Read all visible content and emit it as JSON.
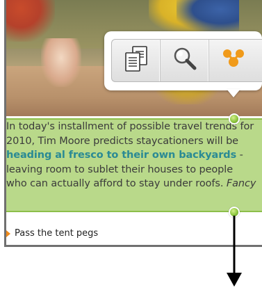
{
  "article": {
    "text_before": "In today's installment of possible travel trends for 2010, Tim Moore predicts staycationers will be ",
    "link_text": "heading al fresco to their own backyards",
    "text_after": " - leaving room to sublet their houses to people who can actually afford to stay under roofs. ",
    "text_italic": "Fancy"
  },
  "related": {
    "label": "Pass the tent pegs"
  },
  "toolbar": {
    "items": [
      {
        "name": "copy",
        "icon": "copy-icon"
      },
      {
        "name": "search",
        "icon": "search-icon"
      },
      {
        "name": "share",
        "icon": "share-icon"
      }
    ]
  },
  "colors": {
    "selection_fill": "#b9d98a",
    "selection_border": "#8dbf4a",
    "link": "#2a8a94",
    "bullet": "#f08a1a",
    "share_icon": "#f09a1a"
  }
}
